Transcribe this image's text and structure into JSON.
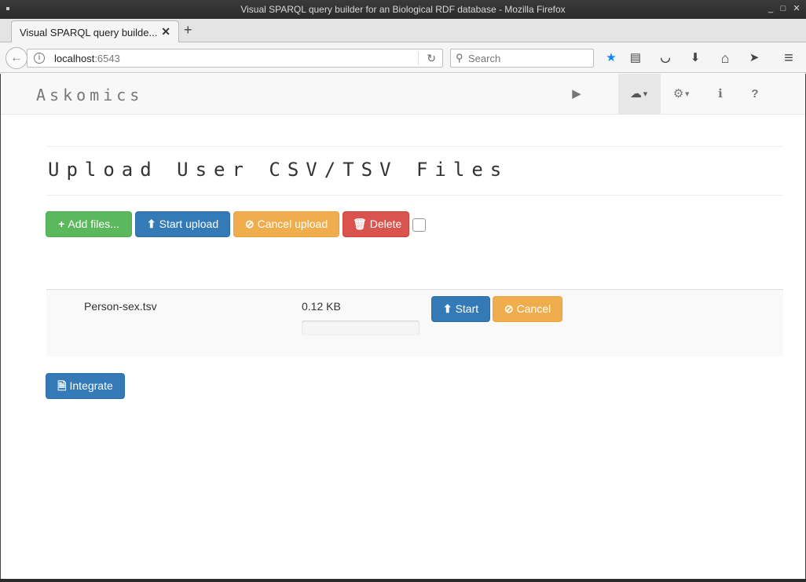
{
  "window": {
    "title": "Visual SPARQL query builder for an Biological RDF database - Mozilla Firefox",
    "min_glyph": "_",
    "max_glyph": "□",
    "close_glyph": "✕"
  },
  "browser": {
    "tab_title": "Visual SPARQL query builde...",
    "tab_close_glyph": "✕",
    "new_tab_glyph": "+",
    "back_glyph": "←",
    "url_host": "localhost",
    "url_port": ":6543",
    "search_placeholder": "Search",
    "icons": [
      "bookmark-star-icon",
      "reading-list-icon",
      "pocket-icon",
      "download-icon",
      "home-icon",
      "send-icon",
      "hamburger-menu-icon"
    ],
    "glyphs": {
      "info": "i",
      "reload": "↻",
      "search": "⚲",
      "star": "★",
      "list": "▤",
      "pocket": "◡",
      "download": "⬇",
      "home": "⌂",
      "send": "➤",
      "menu": "≡"
    },
    "accent_color": "#0a84ff"
  },
  "app": {
    "brand": "Askomics",
    "nav_glyphs": {
      "run": "▶",
      "upload": "☁",
      "settings": "⚙",
      "about": "ℹ",
      "help": "?",
      "caret": "▼"
    }
  },
  "upload": {
    "title": "Upload User CSV/TSV Files",
    "add_files_label": "Add files...",
    "start_upload_label": "Start upload",
    "cancel_upload_label": "Cancel upload",
    "delete_label": "Delete",
    "glyphs": {
      "plus": "+",
      "upload": "⬆",
      "ban": "⊘",
      "trash": "🗑",
      "file": "🗎"
    },
    "files": [
      {
        "name": "Person-sex.tsv",
        "size": "0.12 KB",
        "progress": 0,
        "start_label": "Start",
        "cancel_label": "Cancel"
      }
    ],
    "integrate_label": "Integrate"
  },
  "colors": {
    "success": "#5cb85c",
    "primary": "#337ab7",
    "warning": "#f0ad4e",
    "danger": "#d9534f"
  }
}
